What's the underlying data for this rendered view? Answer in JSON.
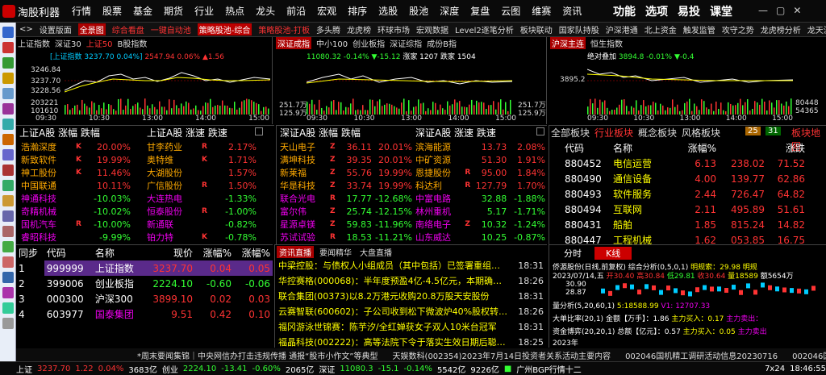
{
  "app": {
    "logo_text": "淘股利器",
    "menus": [
      "行情",
      "股票",
      "基金",
      "期货",
      "行业",
      "热点",
      "龙头",
      "前沿",
      "宏观",
      "排序",
      "选股",
      "股池",
      "深度",
      "复盘",
      "云图",
      "维赛",
      "资讯"
    ],
    "right_menus": [
      "功能",
      "选项",
      "易投",
      "课堂"
    ]
  },
  "tabs": [
    {
      "label": "设置版面",
      "style": "n"
    },
    {
      "label": "全景图",
      "style": "act"
    },
    {
      "label": "综合看盘",
      "style": "red"
    },
    {
      "label": "一键自动池",
      "style": "red"
    },
    {
      "label": "策略股池-综合",
      "style": "redbg"
    },
    {
      "label": "策略股池-打板",
      "style": "red"
    },
    {
      "label": "多头腾",
      "style": "n"
    },
    {
      "label": "龙虎榜",
      "style": "n"
    },
    {
      "label": "环球市场",
      "style": "n"
    },
    {
      "label": "宏观数据",
      "style": "n"
    },
    {
      "label": "Level2逐笔分析",
      "style": "n"
    },
    {
      "label": "板块联动",
      "style": "n"
    },
    {
      "label": "国家队持股",
      "style": "n"
    },
    {
      "label": "沪深港通",
      "style": "n"
    },
    {
      "label": "北上资金",
      "style": "n"
    },
    {
      "label": "触发监管",
      "style": "n"
    },
    {
      "label": "攻守之势",
      "style": "n"
    },
    {
      "label": "龙虎榜分析",
      "style": "n"
    },
    {
      "label": "龙天沪",
      "style": "n"
    }
  ],
  "panel1": {
    "tabs": [
      "上证指数",
      "深证30",
      "上证50",
      "B股指数"
    ],
    "line1": "[上证指数 3237.70 0.04%]",
    "line2": "2547.94 0.06% ▲1.56",
    "prices": [
      "3246.84",
      "3237.70",
      "3228.56"
    ],
    "vols": [
      "203221",
      "101610"
    ],
    "times": [
      "09:30",
      "10:30",
      "13:00",
      "14:00",
      "15:00"
    ]
  },
  "panel2": {
    "tabs": [
      "深证成指",
      "中小100",
      "创业板指",
      "深证综指",
      "成份B指"
    ],
    "line1": "11080.32 -0.14% ▼-15.12",
    "line2": "涨家 1207",
    "line3": "跌家 1504",
    "vols": [
      "251.7万",
      "125.9万"
    ],
    "times": [
      "09:30",
      "10:30",
      "13:00",
      "14:00",
      "15:00"
    ]
  },
  "panel3": {
    "tabs": [
      "沪深主连",
      "恒生指数"
    ],
    "line1": "绝对叠加",
    "line2": "3894.8 -0.01% ▼-0.4",
    "prices": [
      "3895.2"
    ],
    "vols": [
      "80448",
      "54365"
    ],
    "times": [
      "09:30",
      "10:30",
      "13:00",
      "14:00",
      "15:00"
    ]
  },
  "sh_rank": {
    "title": "上证A股 涨幅 跌幅",
    "rows": [
      {
        "n": "浩瀚深度",
        "t": "K",
        "v": "20.00%",
        "c": "r"
      },
      {
        "n": "新致软件",
        "t": "K",
        "v": "19.99%",
        "c": "r"
      },
      {
        "n": "神工股份",
        "t": "K",
        "v": "11.46%",
        "c": "r"
      },
      {
        "n": "中国联通",
        "t": "",
        "v": "10.11%",
        "c": "r"
      },
      {
        "n": "神通科技",
        "t": "",
        "v": "-10.03%",
        "c": "g"
      },
      {
        "n": "奇精机械",
        "t": "",
        "v": "-10.02%",
        "c": "g"
      },
      {
        "n": "国机汽车",
        "t": "R",
        "v": "-10.00%",
        "c": "g"
      },
      {
        "n": "睿昭科技",
        "t": "",
        "v": "-9.99%",
        "c": "g"
      }
    ]
  },
  "sh_speed": {
    "title": "上证A股 涨速 跌速",
    "rows": [
      {
        "n": "甘李药业",
        "t": "R",
        "v": "2.17%",
        "c": "r"
      },
      {
        "n": "奥特维",
        "t": "K",
        "v": "1.71%",
        "c": "r"
      },
      {
        "n": "大湖股份",
        "t": "",
        "v": "1.57%",
        "c": "r"
      },
      {
        "n": "广信股份",
        "t": "R",
        "v": "1.50%",
        "c": "r"
      },
      {
        "n": "大连热电",
        "t": "",
        "v": "-1.33%",
        "c": "g"
      },
      {
        "n": "恒泰股份",
        "t": "R",
        "v": "-1.00%",
        "c": "g"
      },
      {
        "n": "新通联",
        "t": "",
        "v": "-0.82%",
        "c": "g"
      },
      {
        "n": "铂力特",
        "t": "K",
        "v": "-0.78%",
        "c": "g"
      }
    ]
  },
  "sz_rank": {
    "title": "深证A股 涨幅 跌幅",
    "rows": [
      {
        "n": "天山电子",
        "t": "Z",
        "v1": "36.11",
        "v2": "20.01%",
        "c": "r"
      },
      {
        "n": "满坤科技",
        "t": "Z",
        "v1": "39.35",
        "v2": "20.01%",
        "c": "r"
      },
      {
        "n": "新莱福",
        "t": "Z",
        "v1": "55.76",
        "v2": "19.99%",
        "c": "r"
      },
      {
        "n": "华是科技",
        "t": "Z",
        "v1": "33.74",
        "v2": "19.99%",
        "c": "r"
      },
      {
        "n": "联合光电",
        "t": "R",
        "v1": "17.77",
        "v2": "-12.68%",
        "c": "g"
      },
      {
        "n": "富尔伟",
        "t": "Z",
        "v1": "25.74",
        "v2": "-12.15%",
        "c": "g"
      },
      {
        "n": "星源卓镁",
        "t": "Z",
        "v1": "59.83",
        "v2": "-11.96%",
        "c": "g"
      },
      {
        "n": "苏试试验",
        "t": "R",
        "v1": "18.53",
        "v2": "-11.21%",
        "c": "g"
      }
    ]
  },
  "sz_speed": {
    "title": "深证A股 涨速 跌速",
    "rows": [
      {
        "n": "滨海能源",
        "t": "",
        "v1": "13.73",
        "v2": "2.08%",
        "c": "r"
      },
      {
        "n": "中矿资源",
        "t": "",
        "v1": "51.30",
        "v2": "1.91%",
        "c": "r"
      },
      {
        "n": "恩捷股份",
        "t": "R",
        "v1": "95.00",
        "v2": "1.84%",
        "c": "r"
      },
      {
        "n": "科达利",
        "t": "R",
        "v1": "127.79",
        "v2": "1.70%",
        "c": "r"
      },
      {
        "n": "中富电路",
        "t": "",
        "v1": "32.88",
        "v2": "-1.88%",
        "c": "g"
      },
      {
        "n": "林州重机",
        "t": "",
        "v1": "5.17",
        "v2": "-1.71%",
        "c": "g"
      },
      {
        "n": "南络电子",
        "t": "Z",
        "v1": "10.32",
        "v2": "-1.24%",
        "c": "g"
      },
      {
        "n": "山东威达",
        "t": "",
        "v1": "10.25",
        "v2": "-0.87%",
        "c": "g"
      }
    ]
  },
  "boards": {
    "tabs": [
      "全部板块",
      "行业板块",
      "概念板块",
      "风格板块"
    ],
    "up": "25",
    "down": "31",
    "extra": "板块地图",
    "cols": [
      "代码",
      "名称",
      "涨幅%",
      "",
      ""
    ],
    "rows": [
      {
        "code": "880452",
        "name": "电信运营",
        "pct": "6.13",
        "p": "238.02",
        "v": "71.52"
      },
      {
        "code": "880490",
        "name": "通信设备",
        "pct": "4.00",
        "p": "139.77",
        "v": "62.86"
      },
      {
        "code": "880493",
        "name": "软件服务",
        "pct": "2.44",
        "p": "726.47",
        "v": "64.82"
      },
      {
        "code": "880494",
        "name": "互联网",
        "pct": "2.11",
        "p": "495.89",
        "v": "51.61"
      },
      {
        "code": "880431",
        "name": "船舶",
        "pct": "1.85",
        "p": "815.24",
        "v": "14.82"
      },
      {
        "code": "880447",
        "name": "工程机械",
        "pct": "1.62",
        "p": "053.85",
        "v": "16.75"
      }
    ],
    "hdr_extra": "涨跌"
  },
  "watch": {
    "cols": [
      "同步",
      "代码",
      "名称",
      "现价",
      "涨幅%",
      "涨幅%"
    ],
    "rows": [
      {
        "i": "1",
        "code": "999999",
        "name": "上证指数",
        "price": "3237.70",
        "pct": "0.04",
        "pct2": "0.05"
      },
      {
        "i": "2",
        "code": "399006",
        "name": "创业板指",
        "price": "2224.10",
        "pct": "-0.60",
        "pct2": "-0.06"
      },
      {
        "i": "3",
        "code": "000300",
        "name": "沪深300",
        "price": "3899.10",
        "pct": "0.02",
        "pct2": "0.03"
      },
      {
        "i": "4",
        "code": "603977",
        "name": "国泰集团",
        "price": "9.51",
        "pct": "0.42",
        "pct2": "0.10"
      }
    ]
  },
  "news": {
    "tabs": [
      "资讯直播",
      "要闻精华",
      "大盘直播"
    ],
    "items": [
      {
        "t": "中梁控股：与债权人小组成员（其中包括）已签署重组…",
        "tm": "18:31"
      },
      {
        "t": "华控赛格(000068)：半年度预盈4亿-4.5亿元，本期确…",
        "tm": "18:26"
      },
      {
        "t": "联合集团(00373)以8.2万港元收购20.8万股天安股份",
        "tm": "18:31"
      },
      {
        "t": "云赛智联(600602)：子公司收到松下微波炉40%股权转…",
        "tm": "18:26"
      },
      {
        "t": "福冈游泳世锦赛：陈芋汐/全红婵获女子双人10米台冠军",
        "tm": "18:31"
      },
      {
        "t": "福晶科技(002222)：高等法院下令于落实生效日期后聪…",
        "tm": "18:25"
      }
    ]
  },
  "kline": {
    "tabs": [
      "分时",
      "K线"
    ],
    "title": "侨源股份(日线,前复权)",
    "side": "综合分析(0,5,0,1)",
    "side2": "明规索：29.98",
    "side3": "明规",
    "date": "2023/07/14,五",
    "open": "开30.40",
    "high": "高30.84",
    "low": "低29.81",
    "close": "收30.64",
    "vol": "量18589",
    "amt": "额5654万",
    "pr1": "30.90",
    "pr2": "28.87",
    "ind1": "量分析(5,20,60,1)",
    "ind1b": "5:18588.99",
    "ind1c": "V1: 12707.33",
    "ind2": "大单比率(20,1)",
    "ind2b": "金额【万手】：1.86",
    "ind2c": "主力买入：0.17",
    "ind2d": "主力卖出：",
    "ind3": "资金博弈(20,20,1)",
    "ind3b": "总额【亿元】：0.57",
    "ind3c": "主力买入：0.05",
    "ind3d": "主力卖出",
    "year": "2023年"
  },
  "ticker": [
    "*周末要闻集锦｜中央网信办打击违规传播 通报“股市小作文”等典型",
    "天娱数科(002354)2023年7月14日投资者关系活动主要内容",
    "002046国机精工调研活动信息20230716",
    "002046国"
  ],
  "status": {
    "sh": "上证",
    "sh_v": "3237.70",
    "sh_c": "1.22",
    "sh_p": "0.04%",
    "sh_amt": "3683亿",
    "cy": "创业",
    "cy_v": "2224.10",
    "cy_c": "-13.41",
    "cy_p": "-0.60%",
    "cy_amt": "2065亿",
    "sz": "深证",
    "sz_v": "11080.3",
    "sz_c": "-15.1",
    "sz_p": "-0.14%",
    "sz_amt": "5542亿",
    "total": "9226亿",
    "net": "广州BGP行情十二",
    "sess": "7x24",
    "time": "18:46:55",
    "blank": ""
  }
}
